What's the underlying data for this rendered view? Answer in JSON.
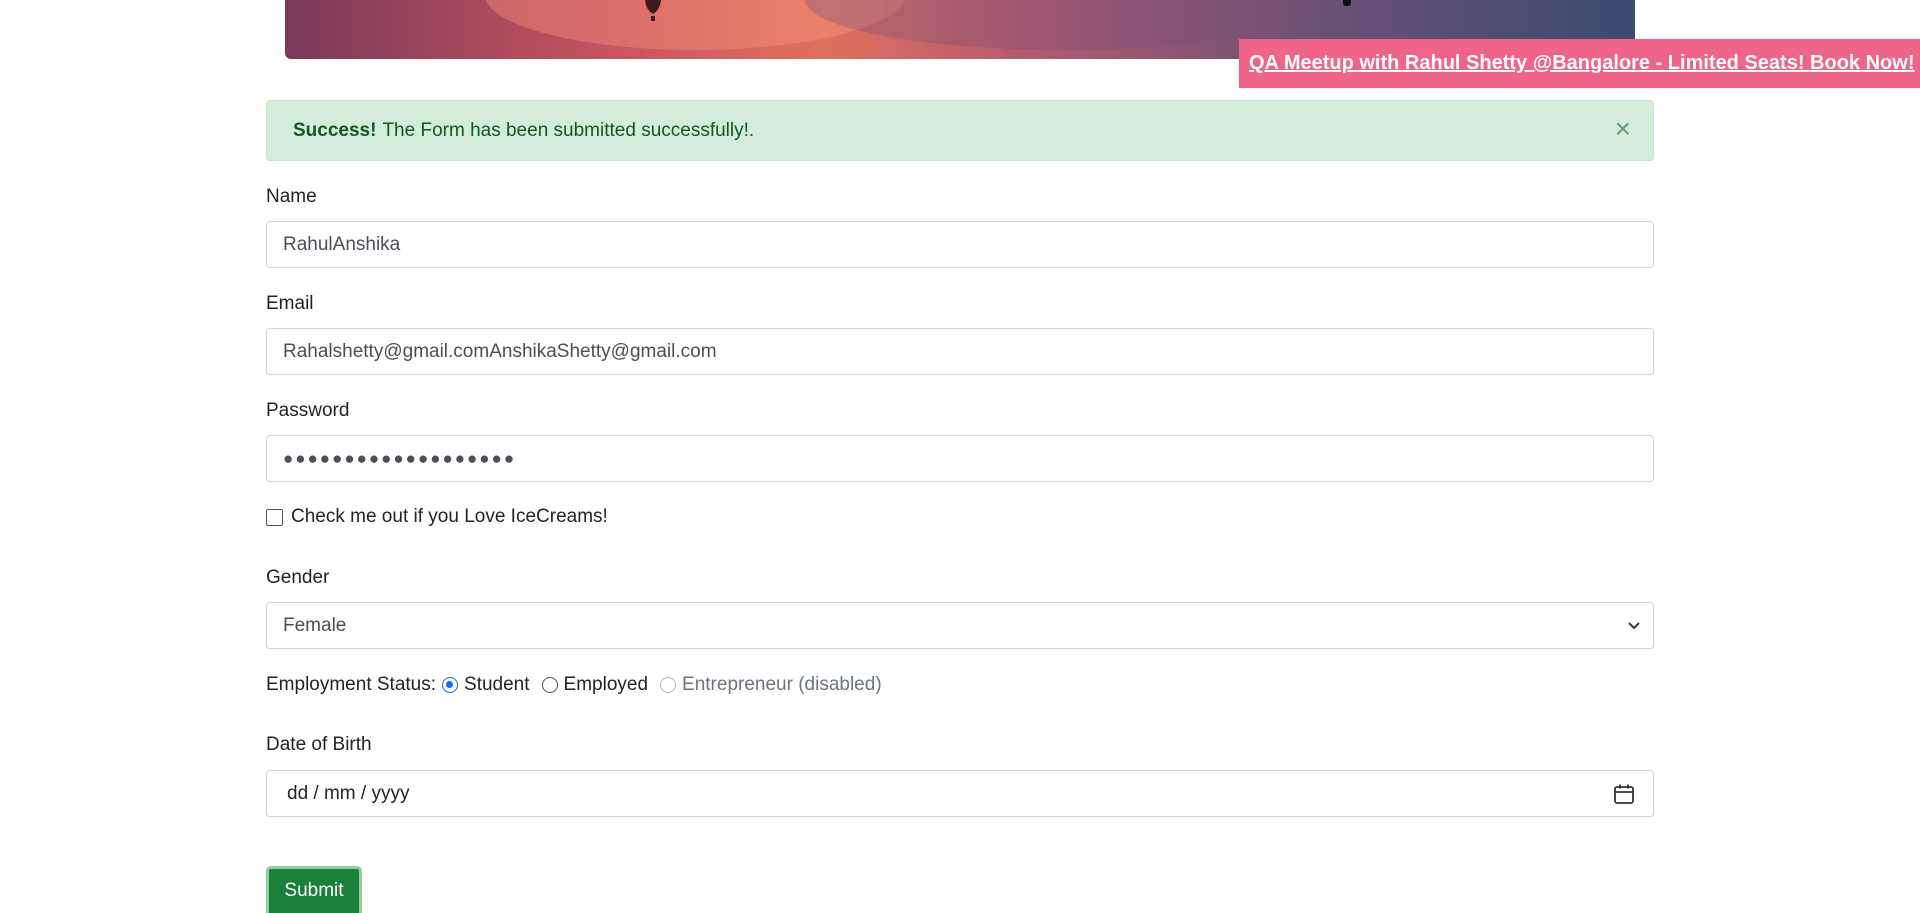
{
  "promo": {
    "text": "QA Meetup with Rahul Shetty @Bangalore - Limited Seats! Book Now!"
  },
  "alert": {
    "strong": "Success!",
    "message": "The Form has been submitted successfully!.",
    "close": "×"
  },
  "form": {
    "name_label": "Name",
    "name_value": "RahulAnshika",
    "email_label": "Email",
    "email_value": "Rahalshetty@gmail.comAnshikaShetty@gmail.com",
    "password_label": "Password",
    "password_mask": "●●●●●●●●●●●●●●●●●●●",
    "checkbox_label": "Check me out if you Love IceCreams!",
    "gender_label": "Gender",
    "gender_value": "Female",
    "employment_label": "Employment Status:",
    "employment_options": [
      {
        "label": "Student",
        "checked": true,
        "disabled": false
      },
      {
        "label": "Employed",
        "checked": false,
        "disabled": false
      },
      {
        "label": "Entrepreneur (disabled)",
        "checked": false,
        "disabled": true
      }
    ],
    "dob_label": "Date of Birth",
    "dob_placeholder": "dd / mm / yyyy",
    "submit_label": "Submit"
  },
  "colors": {
    "promo_bg": "#f0648a",
    "alert_bg": "#d4edda",
    "alert_text": "#155724",
    "submit_bg": "#198039",
    "radio_accent": "#0d6efd"
  },
  "icons": {
    "alert_close": "close-icon",
    "gender_select": "chevron-down-icon",
    "dob_picker": "calendar-icon"
  }
}
